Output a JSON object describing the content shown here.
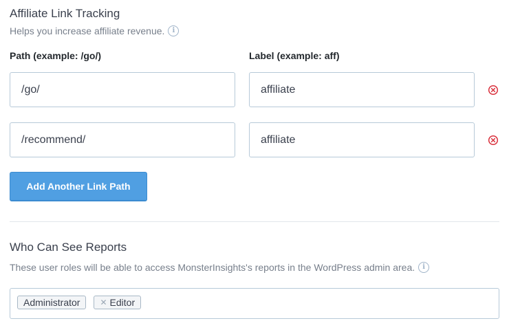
{
  "affiliate": {
    "title": "Affiliate Link Tracking",
    "description": "Helps you increase affiliate revenue.",
    "path_label": "Path (example: /go/)",
    "label_label": "Label (example: aff)",
    "rows": [
      {
        "path": "/go/",
        "label": "affiliate"
      },
      {
        "path": "/recommend/",
        "label": "affiliate"
      }
    ],
    "add_button": "Add Another Link Path"
  },
  "reports": {
    "title": "Who Can See Reports",
    "description": "These user roles will be able to access MonsterInsights's reports in the WordPress admin area.",
    "roles": [
      {
        "label": "Administrator",
        "removable": false
      },
      {
        "label": "Editor",
        "removable": true
      }
    ]
  },
  "colors": {
    "accent": "#509fe2",
    "remove_icon": "#d9303c",
    "info_icon": "#9fb3c8"
  },
  "icons": {
    "info": "info-icon",
    "remove_row": "remove-circle-x-icon",
    "remove_tag": "tag-remove-x-icon"
  }
}
